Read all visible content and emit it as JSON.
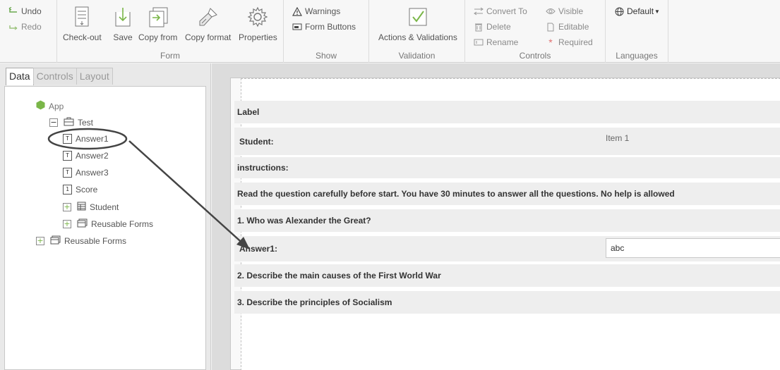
{
  "ribbon": {
    "undo": "Undo",
    "redo": "Redo",
    "form_group": {
      "label": "Form",
      "checkout": "Check-out",
      "save": "Save",
      "copy_from": "Copy from",
      "copy_format": "Copy format",
      "properties": "Properties"
    },
    "show_group": {
      "label": "Show",
      "warnings": "Warnings",
      "form_buttons": "Form Buttons"
    },
    "validation_group": {
      "label": "Validation",
      "actions": "Actions & Validations"
    },
    "controls_group": {
      "label": "Controls",
      "convert_to": "Convert To",
      "delete": "Delete",
      "rename": "Rename",
      "visible": "Visible",
      "editable": "Editable",
      "required": "Required"
    },
    "languages_group": {
      "label": "Languages",
      "default": "Default"
    }
  },
  "left": {
    "tabs": [
      "Data",
      "Controls",
      "Layout"
    ],
    "tree": {
      "app": "App",
      "test": "Test",
      "answer1": "Answer1",
      "answer2": "Answer2",
      "answer3": "Answer3",
      "score": "Score",
      "student": "Student",
      "reusable_forms_child": "Reusable Forms",
      "reusable_forms_root": "Reusable Forms"
    }
  },
  "form": {
    "label": "Label",
    "student_label": "Student:",
    "student_item": "Item 1",
    "instructions": "instructions:",
    "instructions_text": "Read the question carefully before start. You have 30 minutes to answer all the questions. No help is allowed",
    "q1": "1. Who was Alexander the Great?",
    "answer1_label": "Answer1:",
    "answer1_value": "abc",
    "q2": "2. Describe the main causes of the First World War",
    "q3": "3. Describe the principles of Socialism"
  },
  "colors": {
    "accent_green": "#7ab648",
    "ribbon_bg": "#f7f7f7"
  }
}
